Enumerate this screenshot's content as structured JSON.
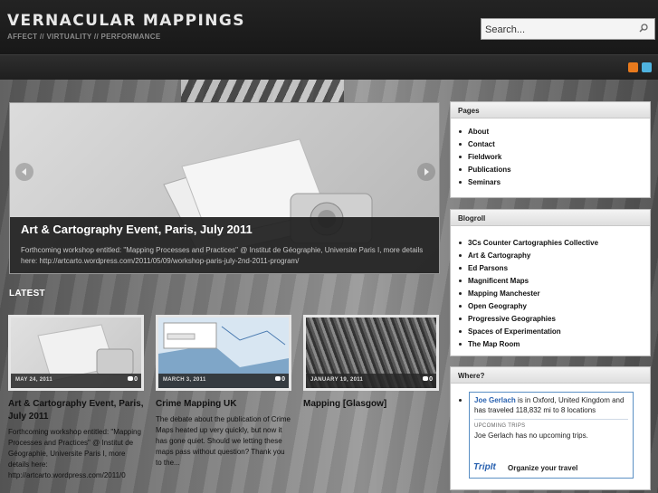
{
  "site": {
    "title": "VERNACULAR MAPPINGS",
    "tagline": "AFFECT // VIRTUALITY // PERFORMANCE"
  },
  "search": {
    "placeholder": "Search..."
  },
  "slider": {
    "title": "Art & Cartography Event, Paris, July 2011",
    "text": "Forthcoming workshop entitled: \"Mapping Processes and Practices\" @ Institut de Géographie, Universite Paris I, more details here: http://artcarto.wordpress.com/2011/05/09/workshop-paris-july-2nd-2011-program/"
  },
  "latest": {
    "label": "LATEST",
    "posts": [
      {
        "date": "MAY 24, 2011",
        "comments": "0",
        "title": "Art & Cartography Event, Paris, July 2011",
        "excerpt": "Forthcoming workshop entitled: \"Mapping Processes and Practices\" @ Institut de Géographie, Universite Paris I, more details here: http://artcarto.wordpress.com/2011/0"
      },
      {
        "date": "MARCH 3, 2011",
        "comments": "0",
        "title": "Crime Mapping UK",
        "excerpt": "The debate about the publication of Crime Maps heated up very quickly, but now it has gone quiet. Should we letting these maps pass without question? Thank you to the..."
      },
      {
        "date": "JANUARY 19, 2011",
        "comments": "0",
        "title": "Mapping [Glasgow]",
        "excerpt": ""
      }
    ]
  },
  "sidebar": {
    "pages": {
      "title": "Pages",
      "items": [
        "About",
        "Contact",
        "Fieldwork",
        "Publications",
        "Seminars"
      ]
    },
    "blogroll": {
      "title": "Blogroll",
      "items": [
        "3Cs Counter Cartographies Collective",
        "Art & Cartography",
        "Ed Parsons",
        "Magnificent Maps",
        "Mapping Manchester",
        "Open Geography",
        "Progressive Geographies",
        "Spaces of Experimentation",
        "The Map Room"
      ]
    },
    "where": {
      "title": "Where?",
      "name": "Joe Gerlach",
      "status": " is in Oxford, United Kingdom and has traveled 118,832 mi to 8 locations",
      "upcoming_label": "UPCOMING TRIPS",
      "upcoming_text": "Joe Gerlach has no upcoming trips.",
      "logo": "TripIt",
      "slogan": "Organize your travel"
    }
  },
  "colors": {
    "header_bg": "#1e1e1e",
    "link_blue": "#2a62b0",
    "rss": "#e87a1d",
    "twitter": "#4fb3e0"
  }
}
